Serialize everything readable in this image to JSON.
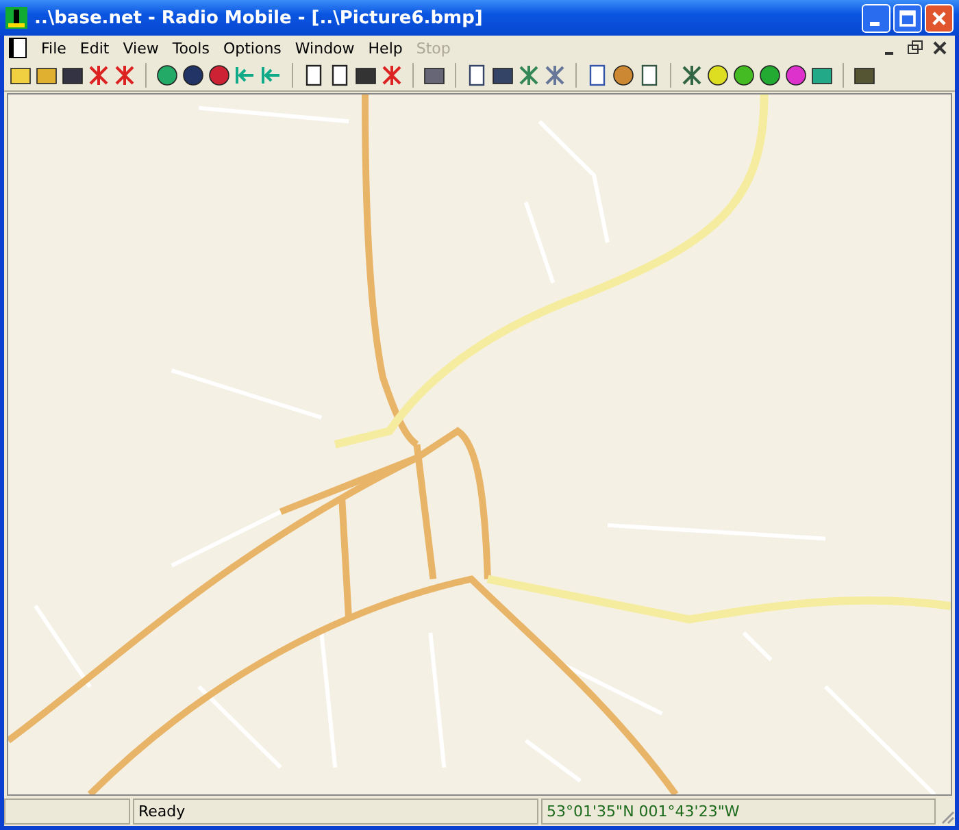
{
  "window": {
    "title": "..\\base.net - Radio Mobile - [..\\Picture6.bmp]"
  },
  "menu": [
    {
      "label": "File",
      "disabled": false
    },
    {
      "label": "Edit",
      "disabled": false
    },
    {
      "label": "View",
      "disabled": false
    },
    {
      "label": "Tools",
      "disabled": false
    },
    {
      "label": "Options",
      "disabled": false
    },
    {
      "label": "Window",
      "disabled": false
    },
    {
      "label": "Help",
      "disabled": false
    },
    {
      "label": "Stop",
      "disabled": true
    }
  ],
  "status_bar": {
    "message": "Ready",
    "coordinates": "53°01'35\"N 001°43'23\"W"
  }
}
